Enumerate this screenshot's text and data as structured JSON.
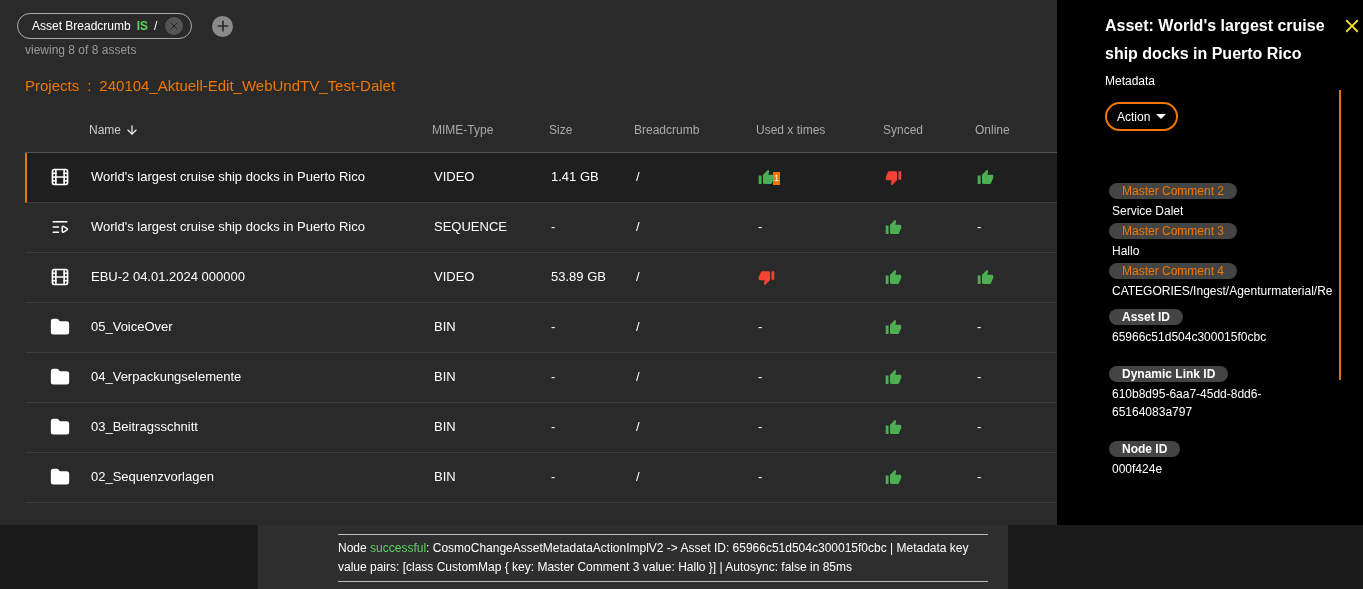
{
  "filter": {
    "field": "Asset Breadcrumb",
    "operator": "IS",
    "value": "/"
  },
  "count": "viewing 8 of 8 assets",
  "breadcrumb": {
    "root": "Projects",
    "separator": ":",
    "current": "240104_Aktuell-Edit_WebUndTV_Test-Dalet"
  },
  "table": {
    "columns": [
      {
        "label": "Name",
        "sorted": true
      },
      {
        "label": "MIME-Type",
        "sorted": false
      },
      {
        "label": "Size",
        "sorted": false
      },
      {
        "label": "Breadcrumb",
        "sorted": false
      },
      {
        "label": "Used x times",
        "sorted": false
      },
      {
        "label": "Synced",
        "sorted": false
      },
      {
        "label": "Online",
        "sorted": false
      }
    ],
    "rows": [
      {
        "kind": "video",
        "selected": true,
        "name": "World's largest cruise ship docks in Puerto Rico",
        "mime": "VIDEO",
        "size": "1.41 GB",
        "breadcrumb": "/",
        "used": {
          "kind": "thumb",
          "positive": true,
          "badge": "1"
        },
        "synced": {
          "kind": "thumb",
          "positive": false
        },
        "online": {
          "kind": "thumb",
          "positive": true
        }
      },
      {
        "kind": "sequence",
        "selected": false,
        "name": "World's largest cruise ship docks in Puerto Rico",
        "mime": "SEQUENCE",
        "size": "-",
        "breadcrumb": "/",
        "used": {
          "kind": "text",
          "text": "-"
        },
        "synced": {
          "kind": "thumb",
          "positive": true
        },
        "online": {
          "kind": "text",
          "text": "-"
        }
      },
      {
        "kind": "video",
        "selected": false,
        "name": "EBU-2 04.01.2024 000000",
        "mime": "VIDEO",
        "size": "53.89 GB",
        "breadcrumb": "/",
        "used": {
          "kind": "thumb",
          "positive": false
        },
        "synced": {
          "kind": "thumb",
          "positive": true
        },
        "online": {
          "kind": "thumb",
          "positive": true
        }
      },
      {
        "kind": "bin",
        "selected": false,
        "name": "05_VoiceOver",
        "mime": "BIN",
        "size": "-",
        "breadcrumb": "/",
        "used": {
          "kind": "text",
          "text": "-"
        },
        "synced": {
          "kind": "thumb",
          "positive": true
        },
        "online": {
          "kind": "text",
          "text": "-"
        }
      },
      {
        "kind": "bin",
        "selected": false,
        "name": "04_Verpackungselemente",
        "mime": "BIN",
        "size": "-",
        "breadcrumb": "/",
        "used": {
          "kind": "text",
          "text": "-"
        },
        "synced": {
          "kind": "thumb",
          "positive": true
        },
        "online": {
          "kind": "text",
          "text": "-"
        }
      },
      {
        "kind": "bin",
        "selected": false,
        "name": "03_Beitragsschnitt",
        "mime": "BIN",
        "size": "-",
        "breadcrumb": "/",
        "used": {
          "kind": "text",
          "text": "-"
        },
        "synced": {
          "kind": "thumb",
          "positive": true
        },
        "online": {
          "kind": "text",
          "text": "-"
        }
      },
      {
        "kind": "bin",
        "selected": false,
        "name": "02_Sequenzvorlagen",
        "mime": "BIN",
        "size": "-",
        "breadcrumb": "/",
        "used": {
          "kind": "text",
          "text": "-"
        },
        "synced": {
          "kind": "thumb",
          "positive": true
        },
        "online": {
          "kind": "text",
          "text": "-"
        }
      }
    ]
  },
  "panel": {
    "title": "Asset: World's largest cruise ship docks in Puerto Rico",
    "subtitle": "Metadata",
    "action": "Action",
    "fields": [
      {
        "label": "Master Comment 2",
        "value": "Service Dalet",
        "changed": true
      },
      {
        "label": "Master Comment 3",
        "value": "Hallo",
        "changed": true
      },
      {
        "label": "Master Comment 4",
        "value": "CATEGORIES/Ingest/Agenturmaterial/Re",
        "changed": true
      },
      {
        "label": "Asset ID",
        "value": "65966c51d504c300015f0cbc",
        "changed": false
      },
      {
        "label": "Dynamic Link ID",
        "value": "610b8d95-6aa7-45dd-8dd6-65164083a797",
        "changed": false
      },
      {
        "label": "Node ID",
        "value": "000f424e",
        "changed": false
      }
    ]
  },
  "log": {
    "prefix": "Node",
    "status": "successful",
    "message": ": CosmoChangeAssetMetadataActionImplV2 -> Asset ID: 65966c51d504c300015f0cbc | Metadata key value pairs: [class CustomMap { key: Master Comment 3 value: Hallo }] | Autosync: false in 85ms"
  }
}
